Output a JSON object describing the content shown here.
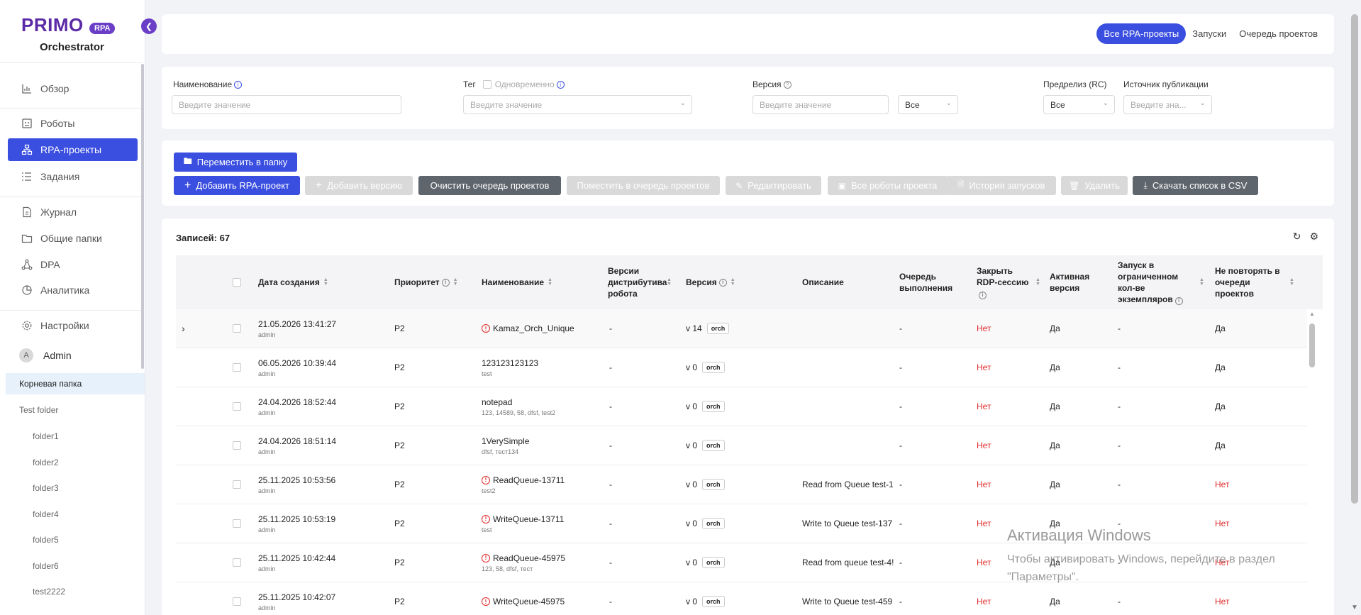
{
  "app": {
    "brand": "PRIMO",
    "brand_badge": "RPA",
    "subtitle": "Orchestrator",
    "accent": "#3a4ee0",
    "brand_color": "#5b2aa6"
  },
  "sidebar": {
    "nav": [
      {
        "label": "Обзор",
        "icon": "chart-icon"
      },
      {
        "label": "Роботы",
        "icon": "robot-icon"
      },
      {
        "label": "RPA-проекты",
        "icon": "hierarchy-icon"
      },
      {
        "label": "Задания",
        "icon": "list-icon"
      },
      {
        "label": "Журнал",
        "icon": "document-icon"
      },
      {
        "label": "Общие папки",
        "icon": "folder-icon"
      },
      {
        "label": "DPA",
        "icon": "nodes-icon"
      },
      {
        "label": "Аналитика",
        "icon": "pie-icon"
      },
      {
        "label": "Настройки",
        "icon": "gear-icon"
      }
    ],
    "user": {
      "initial": "A",
      "name": "Admin"
    },
    "folders": [
      "Корневая папка",
      "Test folder",
      "folder1",
      "folder2",
      "folder3",
      "folder4",
      "folder5",
      "folder6",
      "test2222"
    ]
  },
  "header": {
    "tabs": [
      "Все RPA-проекты",
      "Запуски",
      "Очередь проектов"
    ]
  },
  "filters": {
    "name_label": "Наименование",
    "name_placeholder": "Введите значение",
    "tag_label": "Тег",
    "tag_simultaneous": "Одновременно",
    "tag_placeholder": "Введите значение",
    "version_label": "Версия",
    "version_placeholder": "Введите значение",
    "version_select": "Все",
    "prerelease_label": "Предрелиз (RC)",
    "prerelease_value": "Все",
    "source_label": "Источник публикации",
    "source_placeholder": "Введите зна..."
  },
  "actions": {
    "move_to_folder": "Переместить в папку",
    "add_project": "Добавить RPA-проект",
    "add_version": "Добавить версию",
    "clear_queue": "Очистить очередь проектов",
    "put_in_queue": "Поместить в очередь проектов",
    "edit": "Редактировать",
    "all_robots": "Все роботы проекта",
    "run_history": "История запусков",
    "delete": "Удалить",
    "download_csv": "Скачать список в CSV"
  },
  "table": {
    "records_label": "Записей: 67",
    "columns": {
      "created": "Дата создания",
      "priority": "Приоритет",
      "name": "Наименование",
      "distrib": "Версии дистрибутива робота",
      "version": "Версия",
      "description": "Описание",
      "queue": "Очередь выполнения",
      "rdp": "Закрыть RDP-сессию",
      "active": "Активная версия",
      "limited": "Запуск в ограниченном кол-ве экземпляров",
      "norepeat": "Не повторять в очереди проектов"
    },
    "rows": [
      {
        "date": "21.05.2026 13:41:27",
        "user": "admin",
        "priority": "P2",
        "name": "Kamaz_Orch_Unique",
        "tags": "",
        "warn": true,
        "distrib": "-",
        "version": "v 14",
        "tag": "orch",
        "description": "",
        "queue": "-",
        "rdp": "Нет",
        "active": "Да",
        "limited": "-",
        "norepeat": "Да"
      },
      {
        "date": "06.05.2026 10:39:44",
        "user": "admin",
        "priority": "P2",
        "name": "123123123123",
        "tags": "test",
        "warn": false,
        "distrib": "-",
        "version": "v 0",
        "tag": "orch",
        "description": "",
        "queue": "-",
        "rdp": "Нет",
        "active": "Да",
        "limited": "-",
        "norepeat": "Да"
      },
      {
        "date": "24.04.2026 18:52:44",
        "user": "admin",
        "priority": "P2",
        "name": "notepad",
        "tags": "123, 14589, 58, dfsf, test2",
        "warn": false,
        "distrib": "-",
        "version": "v 0",
        "tag": "orch",
        "description": "",
        "queue": "-",
        "rdp": "Нет",
        "active": "Да",
        "limited": "-",
        "norepeat": "Да"
      },
      {
        "date": "24.04.2026 18:51:14",
        "user": "admin",
        "priority": "P2",
        "name": "1VerySimple",
        "tags": "dfsf, тест134",
        "warn": false,
        "distrib": "-",
        "version": "v 0",
        "tag": "orch",
        "description": "",
        "queue": "-",
        "rdp": "Нет",
        "active": "Да",
        "limited": "-",
        "norepeat": "Да"
      },
      {
        "date": "25.11.2025 10:53:56",
        "user": "admin",
        "priority": "P2",
        "name": "ReadQueue-13711",
        "tags": "test2",
        "warn": true,
        "distrib": "-",
        "version": "v 0",
        "tag": "orch",
        "description": "Read from Queue test-1",
        "queue": "-",
        "rdp": "Нет",
        "active": "Да",
        "limited": "-",
        "norepeat": "Нет"
      },
      {
        "date": "25.11.2025 10:53:19",
        "user": "admin",
        "priority": "P2",
        "name": "WriteQueue-13711",
        "tags": "test",
        "warn": true,
        "distrib": "-",
        "version": "v 0",
        "tag": "orch",
        "description": "Write to Queue test-137",
        "queue": "-",
        "rdp": "Нет",
        "active": "Да",
        "limited": "-",
        "norepeat": "Нет"
      },
      {
        "date": "25.11.2025 10:42:44",
        "user": "admin",
        "priority": "P2",
        "name": "ReadQueue-45975",
        "tags": "123, 58, dfsf, тест",
        "warn": true,
        "distrib": "-",
        "version": "v 0",
        "tag": "orch",
        "description": "Read from queue test-4!",
        "queue": "-",
        "rdp": "Нет",
        "active": "Да",
        "limited": "-",
        "norepeat": "Нет"
      },
      {
        "date": "25.11.2025 10:42:07",
        "user": "admin",
        "priority": "P2",
        "name": "WriteQueue-45975",
        "tags": "",
        "warn": true,
        "distrib": "-",
        "version": "v 0",
        "tag": "orch",
        "description": "Write to Queue test-459",
        "queue": "-",
        "rdp": "Нет",
        "active": "Да",
        "limited": "-",
        "norepeat": "Нет"
      }
    ]
  },
  "watermark": {
    "title": "Активация Windows",
    "line1": "Чтобы активировать Windows, перейдите в раздел",
    "line2": "\"Параметры\"."
  }
}
